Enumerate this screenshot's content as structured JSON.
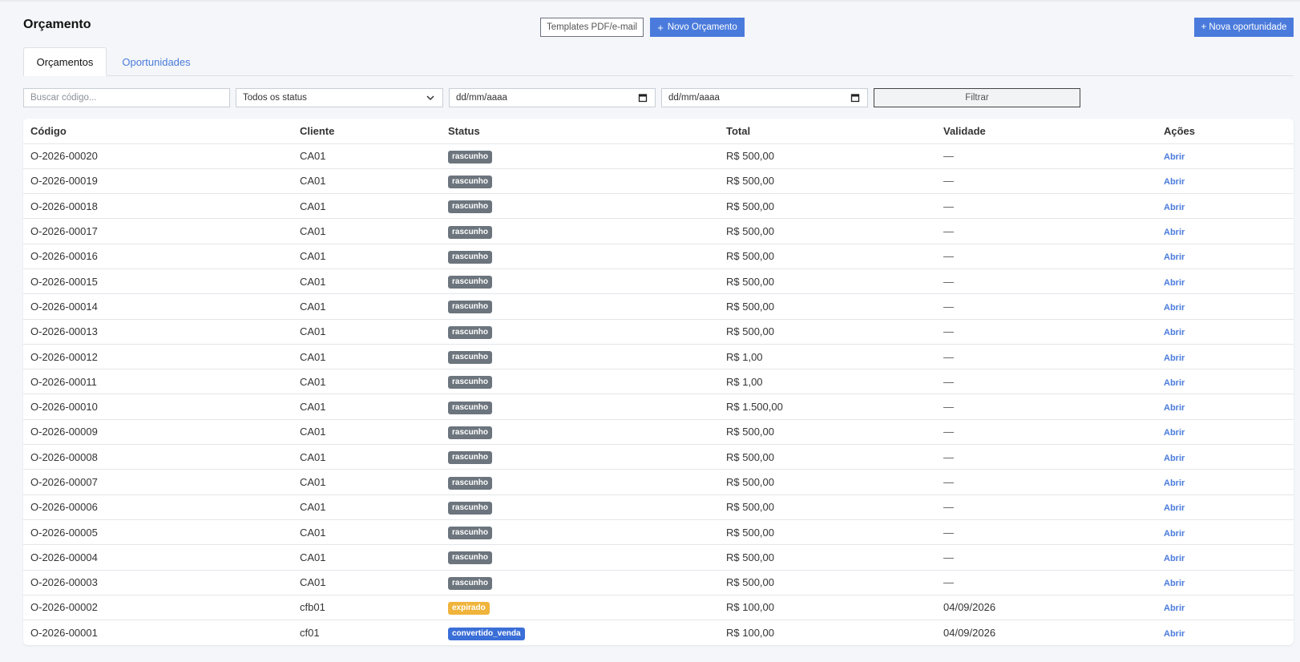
{
  "page": {
    "title": "Orçamento"
  },
  "header": {
    "templates_label": "Templates PDF/e-mail",
    "new_budget_label": "Novo Orçamento",
    "new_budget_plus": "+",
    "new_opportunity_label": "+ Nova oportunidade"
  },
  "tabs": [
    {
      "label": "Orçamentos",
      "active": true
    },
    {
      "label": "Oportunidades",
      "active": false
    }
  ],
  "filters": {
    "search_placeholder": "Buscar código...",
    "status_value": "Todos os status",
    "date_from_placeholder": "dd/mm/aaaa",
    "date_to_placeholder": "dd/mm/aaaa",
    "filter_button": "Filtrar"
  },
  "table": {
    "columns": [
      "Código",
      "Cliente",
      "Status",
      "Total",
      "Validade",
      "Ações"
    ],
    "rows": [
      {
        "code": "O-2026-00020",
        "client": "CA01",
        "status": "rascunho",
        "total": "R$ 500,00",
        "validity": "—",
        "action": "Abrir"
      },
      {
        "code": "O-2026-00019",
        "client": "CA01",
        "status": "rascunho",
        "total": "R$ 500,00",
        "validity": "—",
        "action": "Abrir"
      },
      {
        "code": "O-2026-00018",
        "client": "CA01",
        "status": "rascunho",
        "total": "R$ 500,00",
        "validity": "—",
        "action": "Abrir"
      },
      {
        "code": "O-2026-00017",
        "client": "CA01",
        "status": "rascunho",
        "total": "R$ 500,00",
        "validity": "—",
        "action": "Abrir"
      },
      {
        "code": "O-2026-00016",
        "client": "CA01",
        "status": "rascunho",
        "total": "R$ 500,00",
        "validity": "—",
        "action": "Abrir"
      },
      {
        "code": "O-2026-00015",
        "client": "CA01",
        "status": "rascunho",
        "total": "R$ 500,00",
        "validity": "—",
        "action": "Abrir"
      },
      {
        "code": "O-2026-00014",
        "client": "CA01",
        "status": "rascunho",
        "total": "R$ 500,00",
        "validity": "—",
        "action": "Abrir"
      },
      {
        "code": "O-2026-00013",
        "client": "CA01",
        "status": "rascunho",
        "total": "R$ 500,00",
        "validity": "—",
        "action": "Abrir"
      },
      {
        "code": "O-2026-00012",
        "client": "CA01",
        "status": "rascunho",
        "total": "R$ 1,00",
        "validity": "—",
        "action": "Abrir"
      },
      {
        "code": "O-2026-00011",
        "client": "CA01",
        "status": "rascunho",
        "total": "R$ 1,00",
        "validity": "—",
        "action": "Abrir"
      },
      {
        "code": "O-2026-00010",
        "client": "CA01",
        "status": "rascunho",
        "total": "R$ 1.500,00",
        "validity": "—",
        "action": "Abrir"
      },
      {
        "code": "O-2026-00009",
        "client": "CA01",
        "status": "rascunho",
        "total": "R$ 500,00",
        "validity": "—",
        "action": "Abrir"
      },
      {
        "code": "O-2026-00008",
        "client": "CA01",
        "status": "rascunho",
        "total": "R$ 500,00",
        "validity": "—",
        "action": "Abrir"
      },
      {
        "code": "O-2026-00007",
        "client": "CA01",
        "status": "rascunho",
        "total": "R$ 500,00",
        "validity": "—",
        "action": "Abrir"
      },
      {
        "code": "O-2026-00006",
        "client": "CA01",
        "status": "rascunho",
        "total": "R$ 500,00",
        "validity": "—",
        "action": "Abrir"
      },
      {
        "code": "O-2026-00005",
        "client": "CA01",
        "status": "rascunho",
        "total": "R$ 500,00",
        "validity": "—",
        "action": "Abrir"
      },
      {
        "code": "O-2026-00004",
        "client": "CA01",
        "status": "rascunho",
        "total": "R$ 500,00",
        "validity": "—",
        "action": "Abrir"
      },
      {
        "code": "O-2026-00003",
        "client": "CA01",
        "status": "rascunho",
        "total": "R$ 500,00",
        "validity": "—",
        "action": "Abrir"
      },
      {
        "code": "O-2026-00002",
        "client": "cfb01",
        "status": "expirado",
        "total": "R$ 100,00",
        "validity": "04/09/2026",
        "action": "Abrir"
      },
      {
        "code": "O-2026-00001",
        "client": "cf01",
        "status": "convertido_venda",
        "total": "R$ 100,00",
        "validity": "04/09/2026",
        "action": "Abrir"
      }
    ]
  },
  "colors": {
    "accent": "#4a7bdc",
    "status_rascunho": "#6c757d",
    "status_expirado": "#f0b43c",
    "status_convertido_venda": "#3b6fd8"
  },
  "icons": {
    "status_select": "chevron-down-icon",
    "date_from": "calendar-icon",
    "date_to": "calendar-icon"
  }
}
